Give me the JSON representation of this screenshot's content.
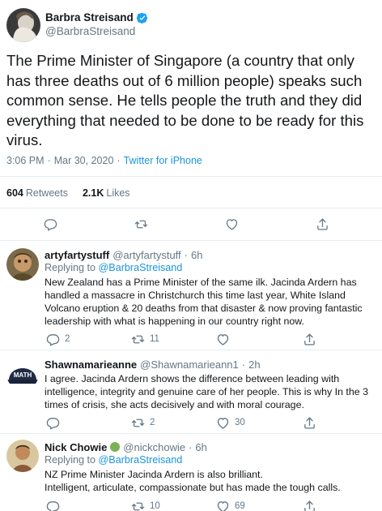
{
  "main_tweet": {
    "author_name": "Barbra Streisand",
    "author_handle": "@BarbraStreisand",
    "verified_icon": "verified-badge-icon",
    "text": "The Prime Minister of Singapore (a country that only has three deaths out of 6 million people) speaks such common sense. He tells people the truth and they did everything that needed to be done to be ready for this virus.",
    "time": "3:06 PM",
    "separator": "·",
    "date": "Mar 30, 2020",
    "source": "Twitter for iPhone",
    "retweets_count": "604",
    "retweets_label": "Retweets",
    "likes_count": "2.1K",
    "likes_label": "Likes"
  },
  "replies": [
    {
      "name": "artyfartystuff",
      "handle": "@artyfartystuff",
      "separator": "·",
      "time": "6h",
      "replying_prefix": "Replying to",
      "replying_to": "@BarbraStreisand",
      "text": "New Zealand has a Prime Minister of the same ilk. Jacinda Ardern has handled a massacre in Christchurch this time last year, White Island Volcano eruption & 20 deaths from that disaster & now proving fantastic leadership with what is happening in our country right now.",
      "reply_count": "2",
      "retweet_count": "11",
      "like_count": ""
    },
    {
      "name": "Shawnamarieanne",
      "handle": "@Shawnamarieann1",
      "separator": "·",
      "time": "2h",
      "avatar_text": "MATH",
      "text": "I agree. Jacinda Ardern shows the difference between leading with intelligence, integrity and genuine care of her people.  This is why In the 3 times of crisis, she acts decisively and with moral courage.",
      "reply_count": "",
      "retweet_count": "2",
      "like_count": "30"
    },
    {
      "name": "Nick Chowie",
      "name_emoji_icon": "green-circle-emoji-icon",
      "handle": "@nickchowie",
      "separator": "·",
      "time": "6h",
      "replying_prefix": "Replying to",
      "replying_to": "@BarbraStreisand",
      "text_line1": "NZ Prime Minister Jacinda Ardern is also brilliant.",
      "text_line2": "Intelligent, articulate, compassionate but has made the tough calls.",
      "reply_count": "",
      "retweet_count": "10",
      "like_count": "69"
    }
  ],
  "colors": {
    "text": "#14171a",
    "secondary": "#657786",
    "link": "#1b95e0",
    "divider": "#e6ecf0",
    "verified": "#1da1f2"
  }
}
